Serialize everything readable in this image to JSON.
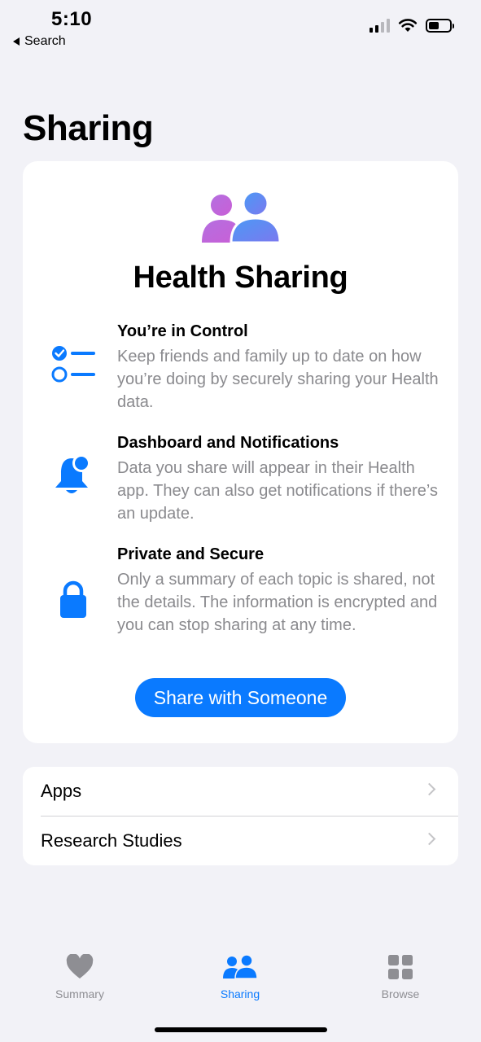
{
  "status_bar": {
    "time": "5:10",
    "back_label": "Search"
  },
  "page_title": "Sharing",
  "health_sharing": {
    "title": "Health Sharing",
    "features": [
      {
        "icon": "checklist-icon",
        "title": "You’re in Control",
        "description": "Keep friends and family up to date on how you’re doing by securely sharing your Health data."
      },
      {
        "icon": "bell-badge-icon",
        "title": "Dashboard and Notifications",
        "description": "Data you share will appear in their Health app. They can also get notifications if there’s an update."
      },
      {
        "icon": "lock-icon",
        "title": "Private and Secure",
        "description": "Only a summary of each topic is shared, not the details. The information is encrypted and you can stop sharing at any time."
      }
    ],
    "share_button_label": "Share with Someone"
  },
  "list": {
    "items": [
      {
        "label": "Apps"
      },
      {
        "label": "Research Studies"
      }
    ]
  },
  "tab_bar": {
    "tabs": [
      {
        "label": "Summary",
        "icon": "heart-icon",
        "active": false
      },
      {
        "label": "Sharing",
        "icon": "people-icon",
        "active": true
      },
      {
        "label": "Browse",
        "icon": "grid-icon",
        "active": false
      }
    ]
  },
  "colors": {
    "accent": "#0a7aff",
    "background": "#f2f2f7",
    "secondary_text": "#8a8a8e"
  }
}
